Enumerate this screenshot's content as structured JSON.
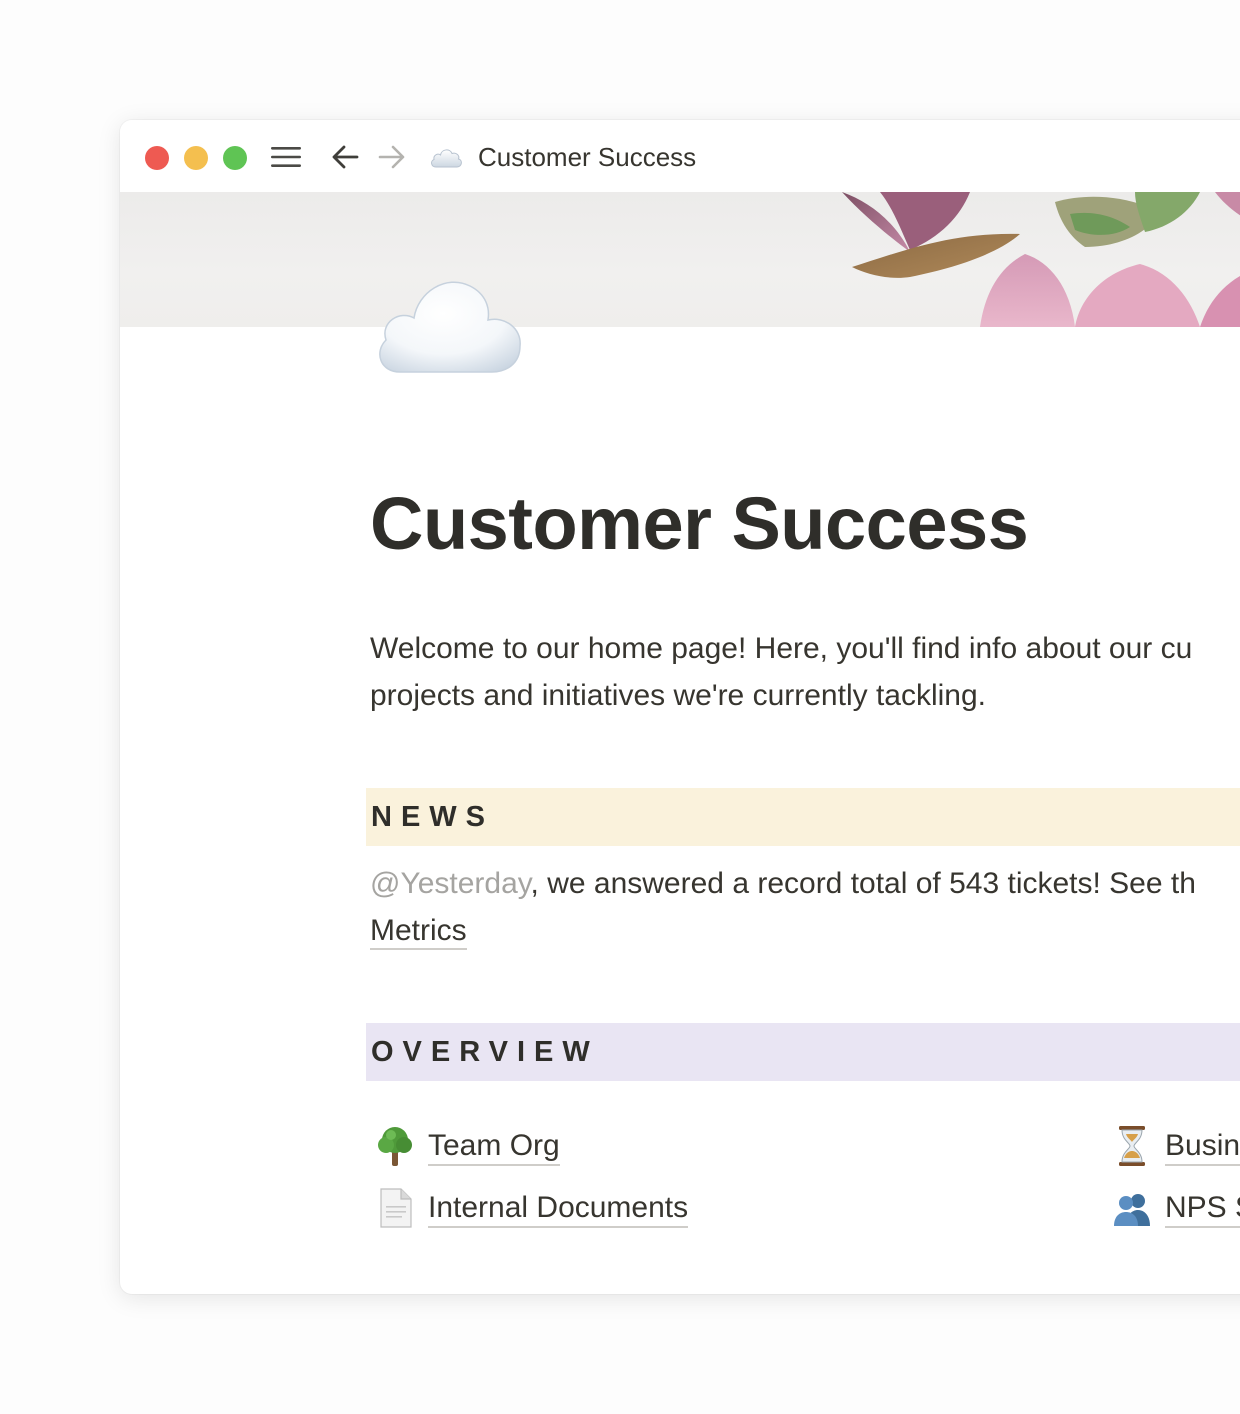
{
  "window": {
    "title": "Customer Success",
    "traffic_colors": {
      "close": "#ee5a52",
      "minimize": "#f4bf4f",
      "zoom": "#5fc454"
    }
  },
  "toolbar": {
    "menu_icon": "hamburger-menu-icon",
    "back_icon": "arrow-left-icon",
    "forward_icon": "arrow-right-icon",
    "page_icon": "cloud-icon"
  },
  "page": {
    "icon": "cloud-emoji",
    "title": "Customer Success",
    "intro_line1": "Welcome to our home page! Here, you'll find info about our cu",
    "intro_line2": "projects and initiatives we're currently tackling."
  },
  "news": {
    "label": "NEWS",
    "color": "#faf2dc",
    "mention": "@Yesterday",
    "text": ", we answered a record total of 543 tickets! See th",
    "link": "Metrics"
  },
  "overview": {
    "label": "OVERVIEW",
    "color": "#e9e5f3",
    "items": [
      {
        "icon": "tree-emoji",
        "label": "Team Org"
      },
      {
        "icon": "page-document-emoji",
        "label": "Internal Documents"
      },
      {
        "icon": "hourglass-emoji",
        "label": "Busin"
      },
      {
        "icon": "busts-in-silhouette-emoji",
        "label": "NPS S"
      }
    ]
  }
}
